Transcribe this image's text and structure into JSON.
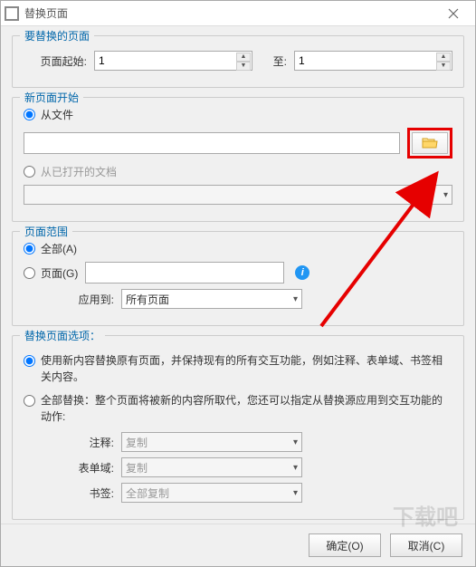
{
  "window": {
    "title": "替换页面"
  },
  "section1": {
    "label": "要替换的页面",
    "from_label": "页面起始:",
    "from_value": "1",
    "to_label": "至:",
    "to_value": "1"
  },
  "section2": {
    "label": "新页面开始",
    "from_file": "从文件",
    "file_path": "",
    "from_open_doc": "从已打开的文档",
    "open_doc_value": ""
  },
  "section3": {
    "label": "页面范围",
    "all": "全部(A)",
    "pages": "页面(G)",
    "pages_value": "",
    "apply_to_label": "应用到:",
    "apply_to_value": "所有页面"
  },
  "section4": {
    "label": "替换页面选项：",
    "opt1": "使用新内容替换原有页面，并保持现有的所有交互功能，例如注释、表单域、书签相关内容。",
    "opt2": "全部替换：整个页面将被新的内容所取代，您还可以指定从替换源应用到交互功能的动作:",
    "sub_annot_label": "注释:",
    "sub_annot_value": "复制",
    "sub_form_label": "表单域:",
    "sub_form_value": "复制",
    "sub_bookmark_label": "书签:",
    "sub_bookmark_value": "全部复制"
  },
  "footer": {
    "ok": "确定(O)",
    "cancel": "取消(C)"
  },
  "watermark": "下载吧"
}
